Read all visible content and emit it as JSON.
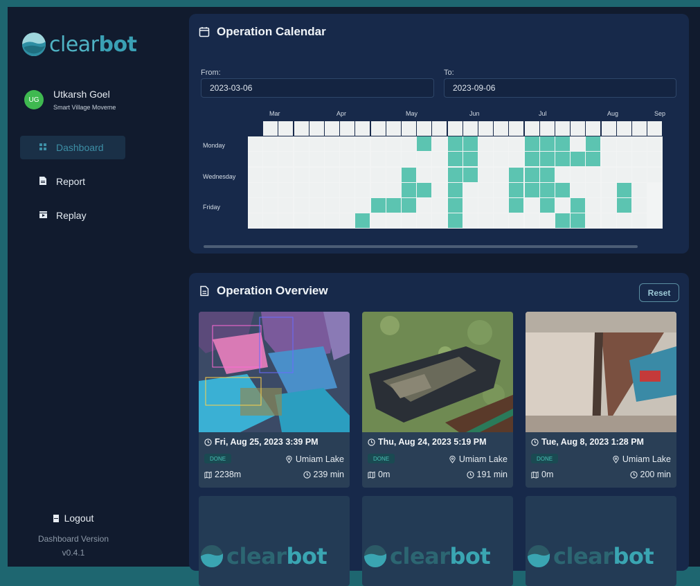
{
  "brand": {
    "name_light": "clear",
    "name_bold": "bot"
  },
  "user": {
    "initials": "UG",
    "name": "Utkarsh Goel",
    "org": "Smart Village Moveme",
    "avatar_color": "#3fb950"
  },
  "nav": [
    {
      "label": "Dashboard",
      "icon": "dashboard-icon",
      "active": true
    },
    {
      "label": "Report",
      "icon": "report-icon",
      "active": false
    },
    {
      "label": "Replay",
      "icon": "replay-icon",
      "active": false
    }
  ],
  "footer": {
    "logout_label": "Logout",
    "version_label": "Dashboard Version",
    "version": "v0.4.1"
  },
  "calendar": {
    "title": "Operation Calendar",
    "from_label": "From:",
    "from_value": "2023-03-06",
    "to_label": "To:",
    "to_value": "2023-09-06",
    "months": [
      "Mar",
      "Apr",
      "May",
      "Jun",
      "Jul",
      "Aug",
      "Sep"
    ],
    "day_labels": [
      "Monday",
      "Wednesday",
      "Friday"
    ],
    "active_color": "#5cc4b1",
    "active_days": [
      [
        11,
        1
      ],
      [
        13,
        1
      ],
      [
        14,
        1
      ],
      [
        18,
        1
      ],
      [
        19,
        1
      ],
      [
        20,
        1
      ],
      [
        22,
        1
      ],
      [
        13,
        2
      ],
      [
        14,
        2
      ],
      [
        18,
        2
      ],
      [
        19,
        2
      ],
      [
        20,
        2
      ],
      [
        21,
        2
      ],
      [
        22,
        2
      ],
      [
        10,
        3
      ],
      [
        13,
        3
      ],
      [
        14,
        3
      ],
      [
        17,
        3
      ],
      [
        18,
        3
      ],
      [
        19,
        3
      ],
      [
        10,
        4
      ],
      [
        11,
        4
      ],
      [
        13,
        4
      ],
      [
        17,
        4
      ],
      [
        18,
        4
      ],
      [
        19,
        4
      ],
      [
        20,
        4
      ],
      [
        24,
        4
      ],
      [
        8,
        5
      ],
      [
        9,
        5
      ],
      [
        10,
        5
      ],
      [
        13,
        5
      ],
      [
        17,
        5
      ],
      [
        19,
        5
      ],
      [
        21,
        5
      ],
      [
        24,
        5
      ],
      [
        7,
        6
      ],
      [
        13,
        6
      ],
      [
        20,
        6
      ],
      [
        21,
        6
      ]
    ]
  },
  "overview": {
    "title": "Operation Overview",
    "reset_label": "Reset",
    "cards": [
      {
        "datetime": "Fri, Aug 25, 2023 3:39 PM",
        "status": "DONE",
        "location": "Umiam Lake",
        "distance": "2238m",
        "duration": "239 min",
        "image": "trash-detection-photo"
      },
      {
        "datetime": "Thu, Aug 24, 2023 5:19 PM",
        "status": "DONE",
        "location": "Umiam Lake",
        "distance": "0m",
        "duration": "191 min",
        "image": "boat-on-lake-photo"
      },
      {
        "datetime": "Tue, Aug 8, 2023 1:28 PM",
        "status": "DONE",
        "location": "Umiam Lake",
        "distance": "0m",
        "duration": "200 min",
        "image": "boat-camera-photo"
      }
    ],
    "placeholder_cards": 3,
    "status_color": "#48c1b5"
  }
}
